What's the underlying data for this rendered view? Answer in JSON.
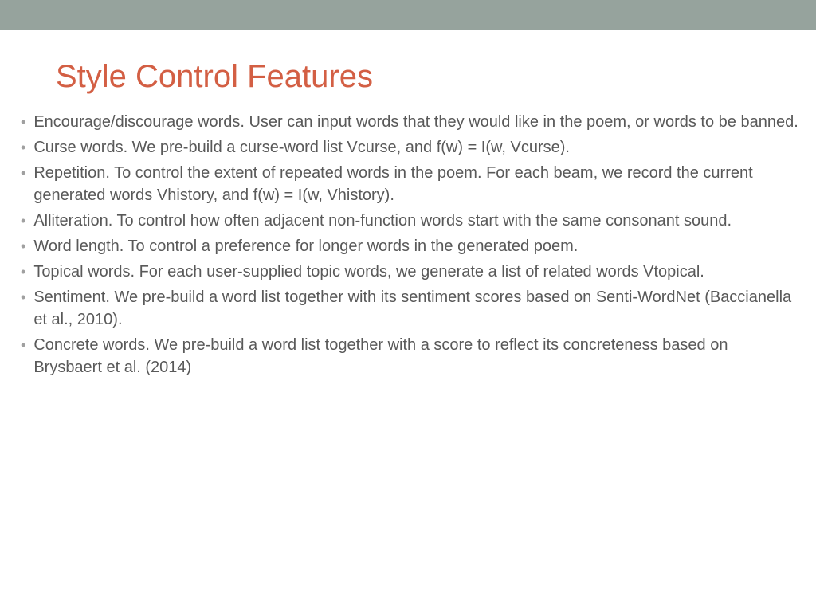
{
  "title": "Style Control Features",
  "bullets": [
    "Encourage/discourage words. User can input words that they would like in the poem, or words to be banned.",
    "Curse words. We pre-build a curse-word list Vcurse, and f(w) = I(w, Vcurse).",
    "Repetition. To control the extent of repeated words in the poem. For each beam, we record the current generated words Vhistory, and f(w) = I(w, Vhistory).",
    "Alliteration. To control how often adjacent non-function words start with the same consonant sound.",
    "Word length. To control a preference for longer words in the generated poem.",
    "Topical words. For each user-supplied topic words, we generate a list of related words Vtopical.",
    "Sentiment. We pre-build a word list together with its sentiment scores based on Senti-WordNet (Baccianella et al., 2010).",
    "Concrete words. We pre-build a word list together with a score to reflect its concreteness based on Brysbaert et al. (2014)"
  ]
}
